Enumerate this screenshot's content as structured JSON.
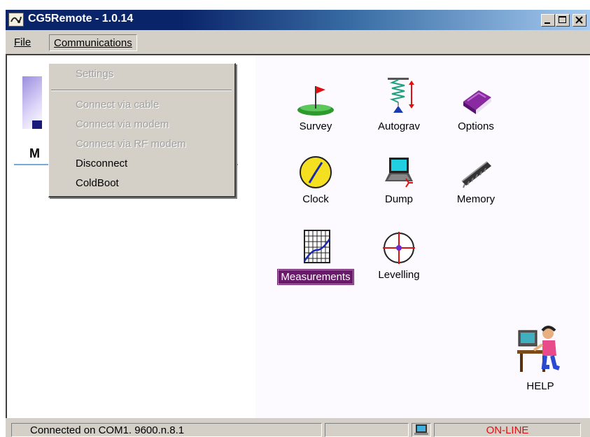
{
  "window": {
    "title": "CG5Remote - 1.0.14"
  },
  "menubar": {
    "file": "File",
    "communications": "Communications"
  },
  "comm_menu": {
    "items": [
      {
        "label": "Settings",
        "enabled": false
      },
      {
        "label": "Connect via cable",
        "enabled": false
      },
      {
        "label": "Connect via modem",
        "enabled": false
      },
      {
        "label": "Connect via RF modem",
        "enabled": false
      },
      {
        "label": "Disconnect",
        "enabled": true
      },
      {
        "label": "ColdBoot",
        "enabled": true
      }
    ]
  },
  "logo": {
    "letter": "M"
  },
  "tools": {
    "survey": {
      "label": "Survey",
      "icon": "survey-flag-icon"
    },
    "autograv": {
      "label": "Autograv",
      "icon": "autograv-spring-icon"
    },
    "options": {
      "label": "Options",
      "icon": "options-book-icon"
    },
    "clock": {
      "label": "Clock",
      "icon": "clock-icon"
    },
    "dump": {
      "label": "Dump",
      "icon": "dump-laptop-icon"
    },
    "memory": {
      "label": "Memory",
      "icon": "memory-chip-icon"
    },
    "measurements": {
      "label": "Measurements",
      "icon": "measurements-graph-icon",
      "selected": true
    },
    "levelling": {
      "label": "Levelling",
      "icon": "levelling-crosshair-icon"
    },
    "help": {
      "label": "HELP",
      "icon": "help-person-icon"
    }
  },
  "statusbar": {
    "connection": "Connected on COM1. 9600.n.8.1",
    "state": "ON-LINE"
  },
  "colors": {
    "online": "#e01010",
    "selection": "#6a1a6a",
    "titlebar": "#0a246a"
  }
}
